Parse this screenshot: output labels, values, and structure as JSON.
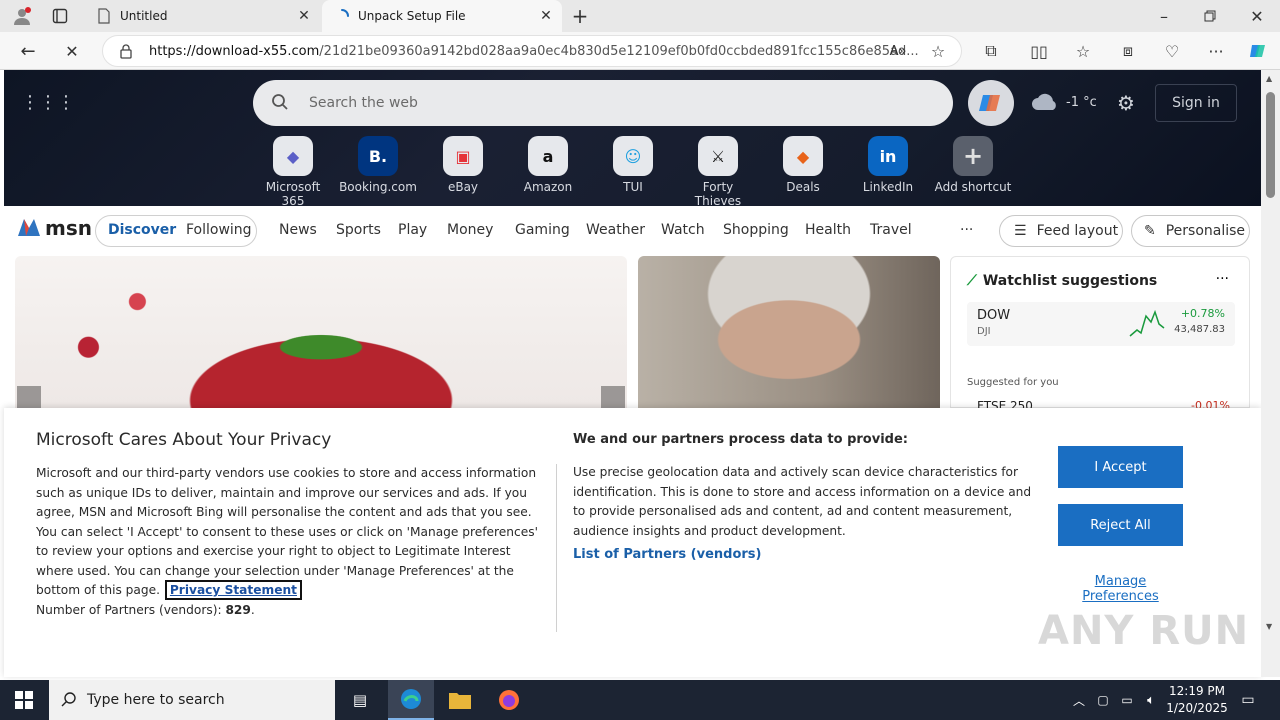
{
  "browser": {
    "tabs": [
      {
        "label": "Untitled"
      },
      {
        "label": "Unpack Setup File"
      }
    ],
    "url_host": "https://download-x55.com",
    "url_path": "/21d21be09360a9142bd028aa9a0ec4b830d5e12109ef0b0fd0ccbded891fcc155c86e85ad..."
  },
  "msn": {
    "search_placeholder": "Search the web",
    "weather": "-1 °c",
    "sign_in": "Sign in",
    "shortcuts": [
      {
        "label": "Microsoft 365",
        "glyph": "◆",
        "color": "#5b5fc7"
      },
      {
        "label": "Booking.com",
        "glyph": "B.",
        "color": "#003580"
      },
      {
        "label": "eBay",
        "glyph": "▣",
        "color": "#e53238"
      },
      {
        "label": "Amazon",
        "glyph": "a",
        "color": "#111111"
      },
      {
        "label": "TUI",
        "glyph": "☺",
        "color": "#1fa0e0"
      },
      {
        "label": "Forty Thieves",
        "glyph": "⚔",
        "color": "#222222"
      },
      {
        "label": "Deals",
        "glyph": "◆",
        "color": "#e8631a"
      },
      {
        "label": "LinkedIn",
        "glyph": "in",
        "color": "#0a66c2"
      },
      {
        "label": "Add shortcut",
        "glyph": "+",
        "color": "#777777"
      }
    ],
    "logo_text": "msn",
    "nav": {
      "discover": "Discover",
      "following": "Following",
      "items": [
        "News",
        "Sports",
        "Play",
        "Money",
        "Gaming",
        "Weather",
        "Watch",
        "Shopping",
        "Health",
        "Travel"
      ],
      "more": "···",
      "feed_layout": "Feed layout",
      "personalise": "Personalise"
    },
    "watchlist": {
      "title": "Watchlist suggestions",
      "more": "···",
      "symbol": "DOW",
      "sub": "DJI",
      "change": "+0.78%",
      "value": "43,487.83",
      "suggested": "Suggested for you",
      "next_symbol": "FTSE 250",
      "next_change": "-0.01%"
    }
  },
  "privacy": {
    "title": "Microsoft Cares About Your Privacy",
    "body": "Microsoft and our third-party vendors use cookies to store and access information such as unique IDs to deliver, maintain and improve our services and ads. If you agree, MSN and Microsoft Bing will personalise the content and ads that you see. You can select 'I Accept' to consent to these uses or click on 'Manage preferences' to review your options and exercise your right to object to Legitimate Interest where used.  You can change your selection under 'Manage Preferences' at the bottom of this page.",
    "privacy_link": "Privacy Statement",
    "partners_label": "Number of Partners (vendors):",
    "partners_count": "829",
    "right_title": "We and our partners process data to provide:",
    "right_body": "Use precise geolocation data and actively scan device characteristics for identification. This is done to store and access information on a device and to provide personalised ads and content, ad and content measurement, audience insights and product development.",
    "partners_link": "List of Partners (vendors)",
    "accept": "I Accept",
    "reject": "Reject All",
    "manage": "Manage Preferences"
  },
  "taskbar": {
    "search_placeholder": "Type here to search",
    "time": "12:19 PM",
    "date": "1/20/2025"
  },
  "watermark": "ANY RUN"
}
